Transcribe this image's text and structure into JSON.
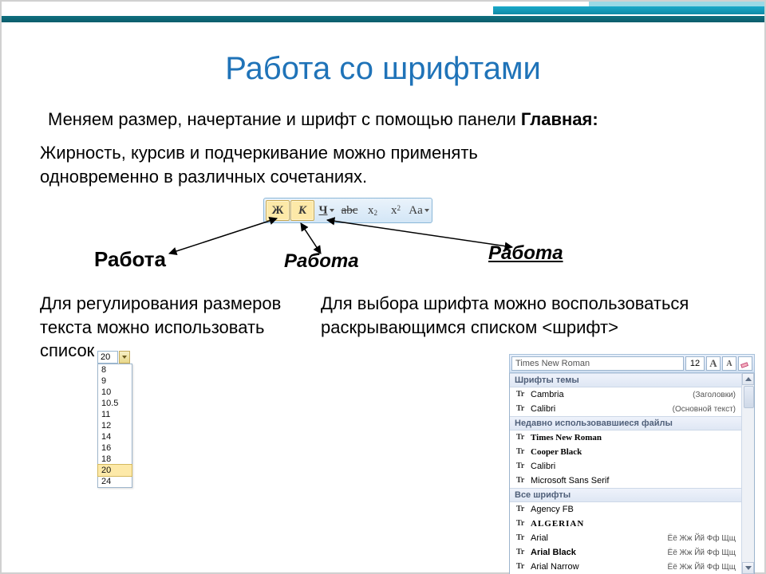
{
  "title": "Работа со шрифтами",
  "subtitle_prefix": "Меняем размер, начертание и шрифт с помощью панели ",
  "subtitle_bold": "Главная:",
  "paragraph1": "Жирность, курсив и подчеркивание можно применять одновременно в различных сочетаниях.",
  "toolbar": {
    "bold": "Ж",
    "italic": "К",
    "underline": "Ч",
    "strike": "abc",
    "subscript_base": "x",
    "subscript_sub": "2",
    "superscript_base": "x",
    "superscript_sup": "2",
    "case": "Aa"
  },
  "examples": {
    "bold": "Работа",
    "italic": "Работа",
    "underline": "Работа"
  },
  "col_left_text": "Для регулирования размеров текста можно использовать список",
  "col_right_text": "Для выбора шрифта можно воспользоваться раскрывающимся списком <шрифт>",
  "size_widget": {
    "current": "20",
    "options": [
      "8",
      "9",
      "10",
      "10.5",
      "11",
      "12",
      "14",
      "16",
      "18",
      "20",
      "24"
    ],
    "selected_index": 9
  },
  "font_widget": {
    "current": "Times New Roman",
    "size_value": "12",
    "grow_label": "A",
    "shrink_label": "A",
    "section_theme": "Шрифты темы",
    "theme_fonts": [
      {
        "name": "Cambria",
        "note": "(Заголовки)"
      },
      {
        "name": "Calibri",
        "note": "(Основной текст)"
      }
    ],
    "section_recent": "Недавно использовавшиеся файлы",
    "recent_fonts": [
      {
        "name": "Times New Roman"
      },
      {
        "name": "Cooper Black"
      },
      {
        "name": "Calibri"
      },
      {
        "name": "Microsoft Sans Serif"
      }
    ],
    "section_all": "Все шрифты",
    "all_fonts": [
      {
        "name": "Agency FB"
      },
      {
        "name": "ALGERIAN"
      },
      {
        "name": "Arial",
        "sample": "Ёё Жж Йй Фф Щщ"
      },
      {
        "name": "Arial Black",
        "sample": "Ёё Жж Йй Фф Щщ"
      },
      {
        "name": "Arial Narrow",
        "sample": "Ёё Жж Йй Фф Щщ"
      }
    ]
  }
}
